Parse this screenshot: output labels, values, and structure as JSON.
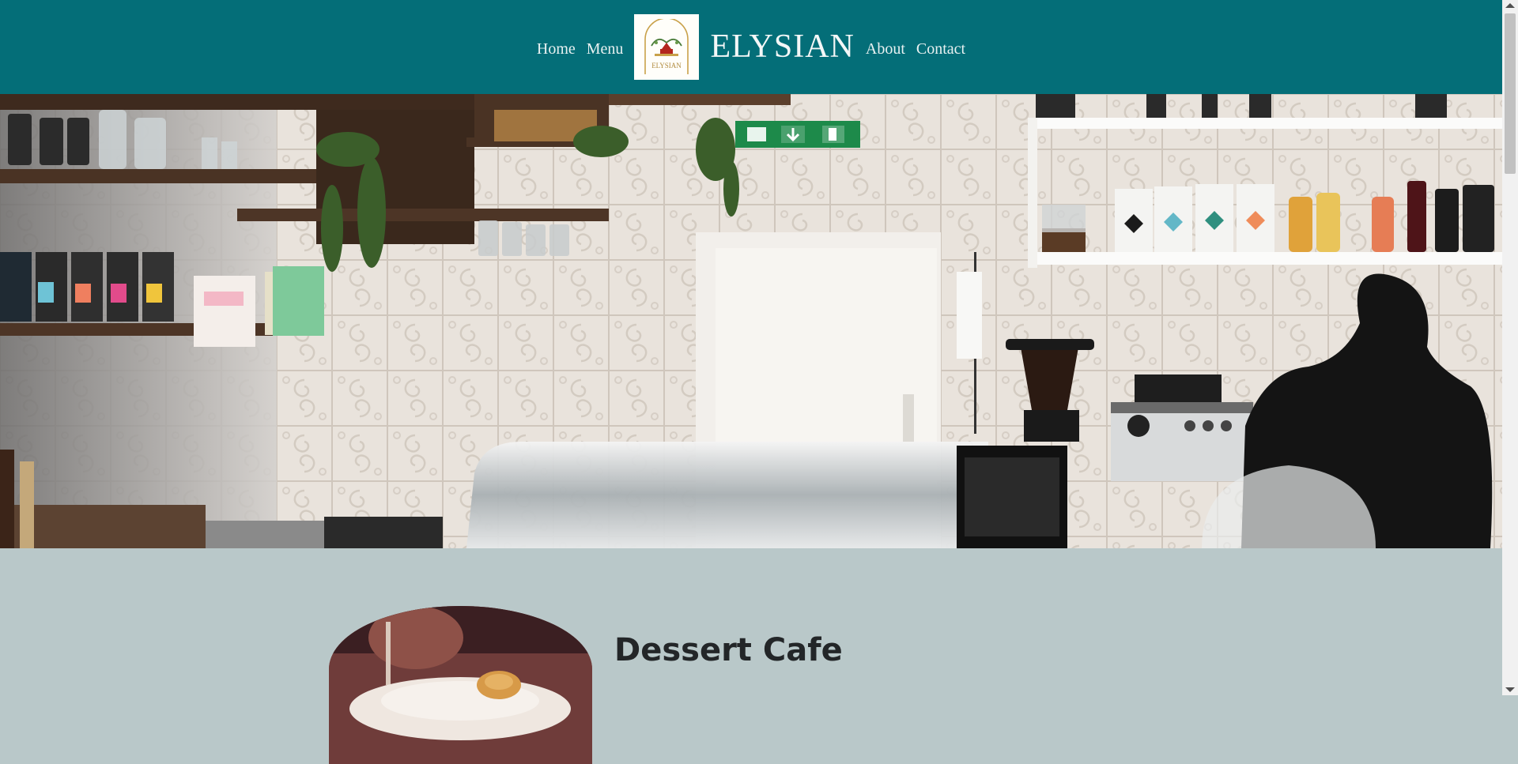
{
  "header": {
    "nav_left": [
      "Home",
      "Menu"
    ],
    "nav_right": [
      "About",
      "Contact"
    ],
    "brand": "ELYSIAN",
    "logo_text": "ELYSIAN",
    "background_color": "#046e78"
  },
  "hero": {
    "image": "cafe-interior-photo",
    "sign_icons": [
      "running-man-icon",
      "arrow-down-icon",
      "door-icon"
    ]
  },
  "feature": {
    "title": "Dessert Cafe",
    "image": "dessert-plate-photo"
  },
  "scrollbar": {
    "icons": [
      "scroll-up-arrow-icon",
      "scroll-down-arrow-icon"
    ]
  }
}
